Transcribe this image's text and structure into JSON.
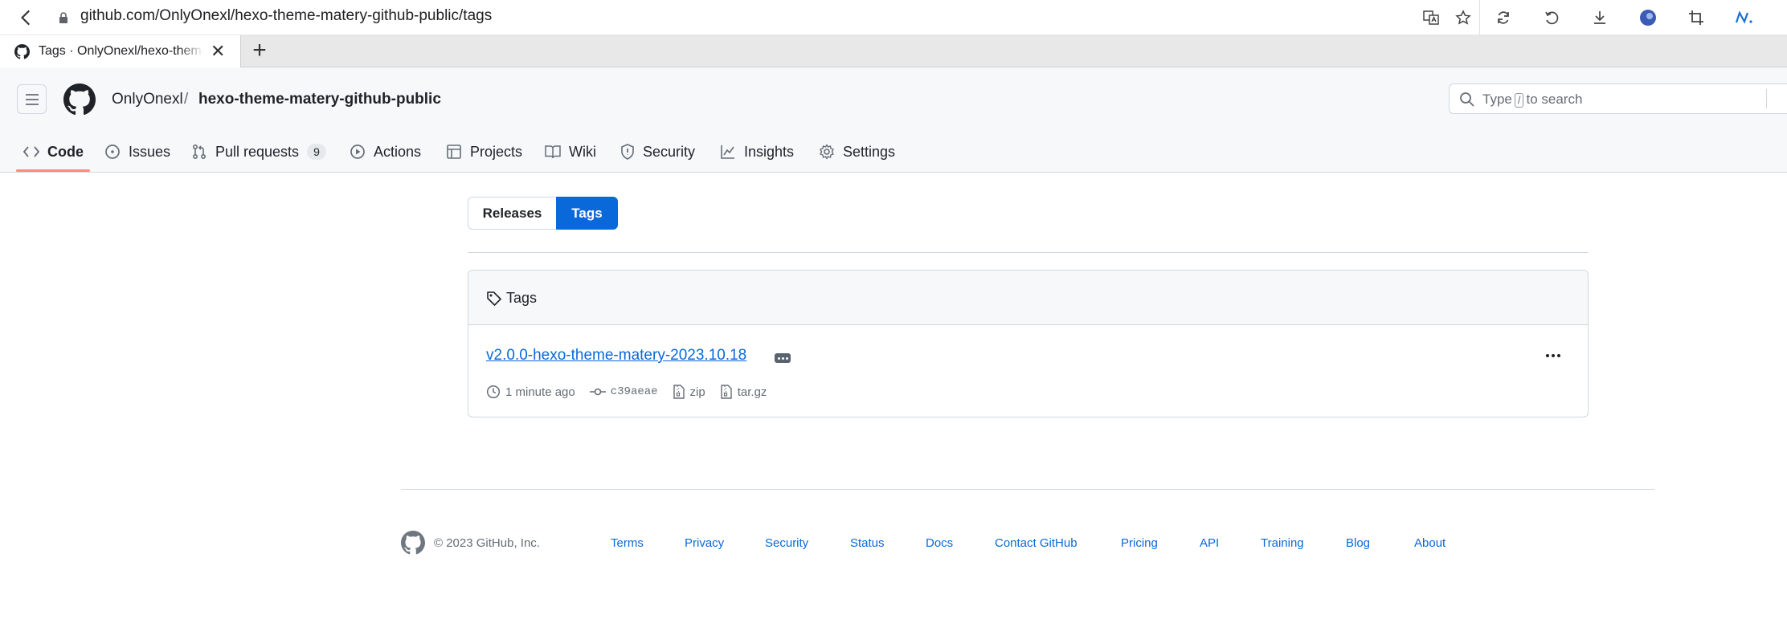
{
  "browser": {
    "url_host": "github.com",
    "url_path": "/OnlyOnexl/hexo-theme-matery-github-public/tags",
    "tab_title": "Tags · OnlyOnexl/hexo-theme-matery-github-public",
    "tab_close": "✕",
    "new_tab": "+"
  },
  "header": {
    "owner": "OnlyOnexl",
    "separator": "/",
    "repo": "hexo-theme-matery-github-public",
    "search": {
      "prefix": "Type",
      "key": "/",
      "suffix": "to search"
    }
  },
  "repo_nav": {
    "code": "Code",
    "issues": "Issues",
    "pull_requests": "Pull requests",
    "pull_requests_count": "9",
    "actions": "Actions",
    "projects": "Projects",
    "wiki": "Wiki",
    "security": "Security",
    "insights": "Insights",
    "settings": "Settings"
  },
  "subnav": {
    "releases": "Releases",
    "tags": "Tags"
  },
  "tags_box": {
    "header": "Tags",
    "tag": {
      "name": "v2.0.0-hexo-theme-matery-2023.10.18",
      "time": "1 minute ago",
      "sha": "c39aeae",
      "zip": "zip",
      "targz": "tar.gz"
    }
  },
  "footer": {
    "copyright": "© 2023 GitHub, Inc.",
    "links": {
      "terms": "Terms",
      "privacy": "Privacy",
      "security": "Security",
      "status": "Status",
      "docs": "Docs",
      "contact": "Contact GitHub",
      "pricing": "Pricing",
      "api": "API",
      "training": "Training",
      "blog": "Blog",
      "about": "About"
    }
  },
  "colors": {
    "accent": "#0969da",
    "nav_underline": "#fd8c73",
    "header_bg": "#f6f8fa",
    "border": "#d0d7de",
    "muted_text": "#656d76"
  }
}
